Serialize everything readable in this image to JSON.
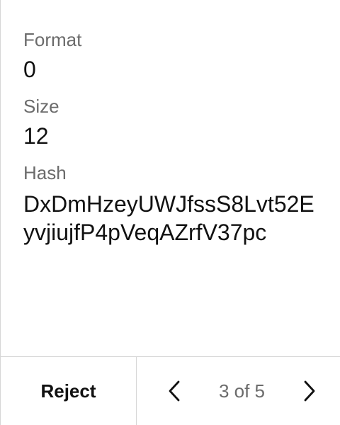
{
  "fields": {
    "format": {
      "label": "Format",
      "value": "0"
    },
    "size": {
      "label": "Size",
      "value": "12"
    },
    "hash": {
      "label": "Hash",
      "value": "DxDmHzeyUWJfssS8Lvt52EyvjiujfP4pVeqAZrfV37pc"
    }
  },
  "footer": {
    "reject_label": "Reject",
    "pagination": {
      "text": "3 of 5",
      "current": 3,
      "total": 5
    }
  },
  "icons": {
    "previous": "chevron-left-icon",
    "next": "chevron-right-icon"
  }
}
